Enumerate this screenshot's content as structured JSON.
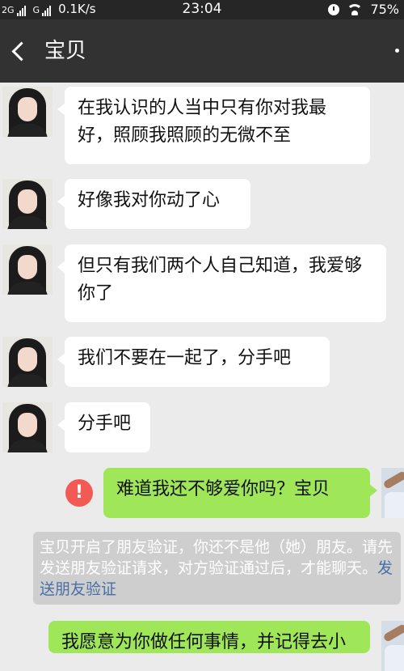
{
  "status": {
    "network": "2G",
    "network2": "G",
    "speed": "0.1K/s",
    "time": "23:04",
    "battery": "75%"
  },
  "header": {
    "title": "宝贝"
  },
  "messages": [
    {
      "side": "left",
      "text": "在我认识的人当中只有你对我最好，照顾我照顾的无微不至"
    },
    {
      "side": "left",
      "text": "好像我对你动了心"
    },
    {
      "side": "left",
      "text": "但只有我们两个人自己知道，我爱够你了"
    },
    {
      "side": "left",
      "text": "我们不要在一起了，分手吧"
    },
    {
      "side": "left",
      "text": "分手吧"
    },
    {
      "side": "right",
      "text": "难道我还不够爱你吗？宝贝",
      "failed": true
    }
  ],
  "system_notice": {
    "text": "宝贝开启了朋友验证，你还不是他（她）朋友。请先发送朋友验证请求，对方验证通过后，才能聊天。",
    "link": "发送朋友验证"
  },
  "partial_message": {
    "text": "我愿意为你做任何事情，并记得去小"
  },
  "colors": {
    "chat_bg": "#ebebeb",
    "titlebar": "#323232",
    "my_bubble": "#9fe658",
    "error": "#f35a55"
  }
}
